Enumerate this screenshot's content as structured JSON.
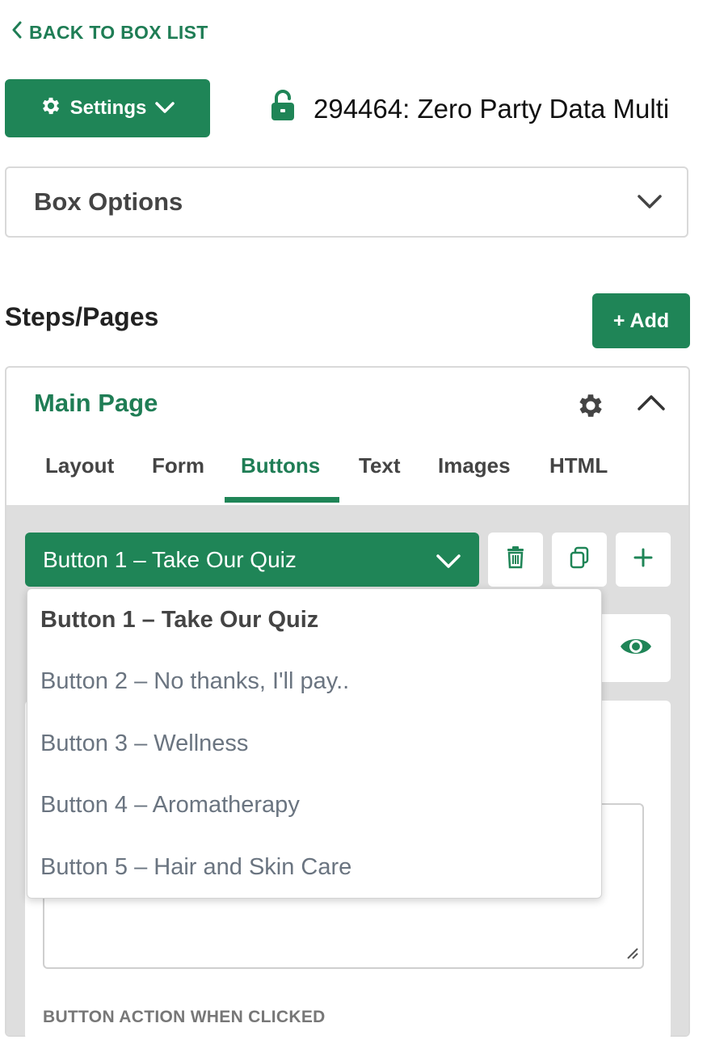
{
  "nav": {
    "back_label": "BACK TO BOX LIST"
  },
  "header": {
    "settings_label": "Settings",
    "box_title": "294464: Zero Party Data Multi"
  },
  "box_options": {
    "label": "Box Options"
  },
  "steps": {
    "title": "Steps/Pages",
    "add_label": "+ Add"
  },
  "main_page": {
    "title": "Main Page",
    "tabs": [
      {
        "label": "Layout"
      },
      {
        "label": "Form"
      },
      {
        "label": "Buttons"
      },
      {
        "label": "Text"
      },
      {
        "label": "Images"
      },
      {
        "label": "HTML"
      }
    ],
    "active_tab": "Buttons"
  },
  "button_select": {
    "selected": "Button 1 – Take Our Quiz",
    "options": [
      "Button 1 – Take Our Quiz",
      "Button 2 – No thanks, I'll pay..",
      "Button 3 – Wellness",
      "Button 4 – Aromatherapy",
      "Button 5 – Hair and Skin Care"
    ]
  },
  "form": {
    "action_label": "BUTTON ACTION WHEN CLICKED"
  },
  "colors": {
    "brand": "#1f8557",
    "brand_text": "#1f7d55",
    "panel_gray": "#dedede"
  },
  "icons": [
    "chevron-left-icon",
    "gear-icon",
    "chevron-down-icon",
    "lock-open-icon",
    "chevron-up-icon",
    "trash-icon",
    "copy-icon",
    "plus-icon",
    "eye-icon",
    "resize-handle-icon"
  ]
}
